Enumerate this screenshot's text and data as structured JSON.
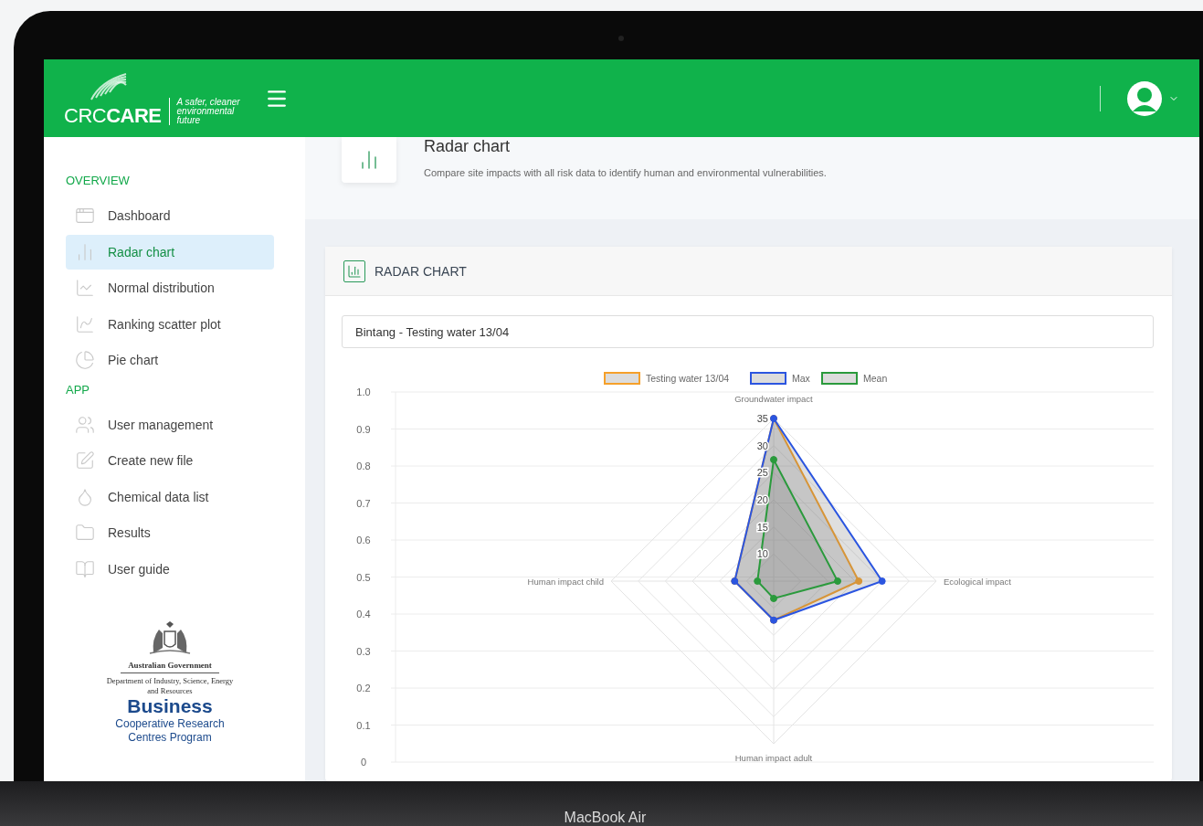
{
  "header": {
    "logo": {
      "wordmark": "CRC**CARE**",
      "tagline": "A safer, cleaner environmental future"
    }
  },
  "sidebar": {
    "sections": [
      {
        "title": "OVERVIEW",
        "items": [
          {
            "label": "Dashboard",
            "selected": false
          },
          {
            "label": "Radar chart",
            "selected": true
          },
          {
            "label": "Normal distribution",
            "selected": false
          },
          {
            "label": "Ranking scatter plot",
            "selected": false
          },
          {
            "label": "Pie chart",
            "selected": false
          }
        ]
      },
      {
        "title": "APP",
        "items": [
          {
            "label": "User management",
            "selected": false
          },
          {
            "label": "Create new file",
            "selected": false
          },
          {
            "label": "Chemical data list",
            "selected": false
          },
          {
            "label": "Results",
            "selected": false
          },
          {
            "label": "User guide",
            "selected": false
          }
        ]
      }
    ],
    "sponsor": {
      "government": "Australian Government",
      "department": "Department of Industry, Science, Energy and Resources",
      "program_title": "Business",
      "program_subtitle": "Cooperative Research Centres Program"
    }
  },
  "page_header": {
    "title": "Radar chart",
    "description": "Compare site impacts with all risk data to identify human and environmental vulnerabilities."
  },
  "card": {
    "title": "RADAR CHART",
    "site_select": {
      "value": "Bintang - Testing water 13/04"
    },
    "chart_left_axis_ticks": [
      "1.0",
      "0.9",
      "0.8",
      "0.7",
      "0.6",
      "0.5",
      "0.4",
      "0.3",
      "0.2",
      "0.1",
      "0"
    ],
    "radar": {
      "categories": [
        "Groundwater impact",
        "Ecological impact",
        "Human impact adult",
        "Human impact child"
      ],
      "series": [
        {
          "name": "Testing water 13/04",
          "color": "#f5a02a"
        },
        {
          "name": "Max",
          "color": "#2b55e0"
        },
        {
          "name": "Mean",
          "color": "#2a9a3c"
        }
      ],
      "radial_ticks": [
        "35",
        "30",
        "25",
        "20",
        "15",
        "10"
      ]
    }
  },
  "device": {
    "label": "MacBook Air"
  }
}
